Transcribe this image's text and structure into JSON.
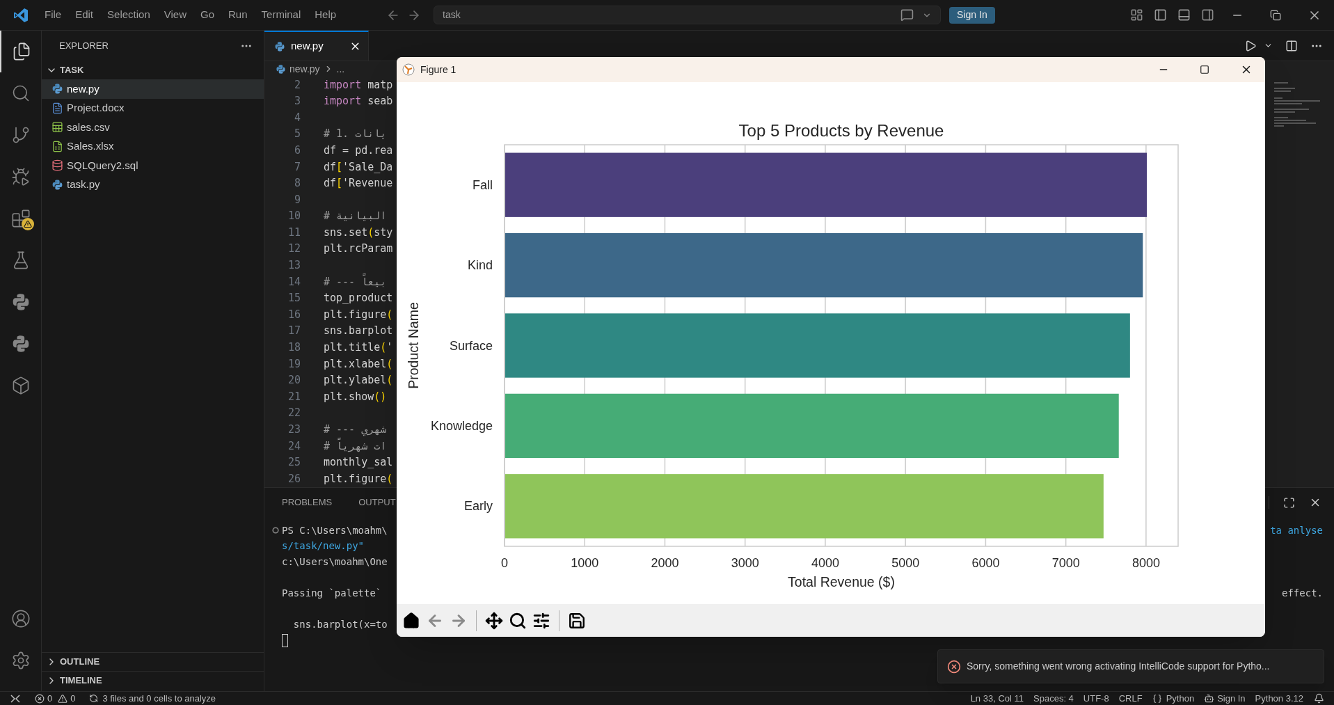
{
  "title_bar": {
    "menu": [
      "File",
      "Edit",
      "Selection",
      "View",
      "Go",
      "Run",
      "Terminal",
      "Help"
    ],
    "search": {
      "value": "task"
    },
    "sign_in": "Sign In"
  },
  "activity_bar": {
    "top": [
      {
        "kind": "explorer",
        "selected": true
      },
      {
        "kind": "search",
        "selected": false
      },
      {
        "kind": "source_control",
        "selected": false
      },
      {
        "kind": "run_debug",
        "selected": false
      },
      {
        "kind": "extensions",
        "selected": false,
        "warning": true
      },
      {
        "kind": "testing",
        "selected": false
      },
      {
        "kind": "python",
        "selected": false
      },
      {
        "kind": "python",
        "selected": false
      },
      {
        "kind": "containers",
        "selected": false
      }
    ],
    "bottom": [
      {
        "kind": "account"
      },
      {
        "kind": "settings"
      }
    ]
  },
  "sidebar": {
    "title": "EXPLORER",
    "folder": {
      "label": "TASK",
      "expanded": true,
      "files": [
        {
          "name": "new.py",
          "kind": "python",
          "selected": true
        },
        {
          "name": "Project.docx",
          "kind": "word",
          "selected": false
        },
        {
          "name": "sales.csv",
          "kind": "csv",
          "selected": false
        },
        {
          "name": "Sales.xlsx",
          "kind": "excel",
          "selected": false
        },
        {
          "name": "SQLQuery2.sql",
          "kind": "sql",
          "selected": false
        },
        {
          "name": "task.py",
          "kind": "python",
          "selected": false
        }
      ]
    },
    "sections": [
      {
        "label": "OUTLINE",
        "expanded": false
      },
      {
        "label": "TIMELINE",
        "expanded": false
      }
    ]
  },
  "editor": {
    "tabs": [
      {
        "label": "new.py",
        "selected": true
      }
    ],
    "breadcrumb": [
      "new.py",
      "..."
    ],
    "lines": [
      {
        "number": "2",
        "tokens": [
          {
            "text": "import",
            "kind": "keyword"
          },
          {
            "text": " matp",
            "kind": "plain"
          }
        ]
      },
      {
        "number": "3",
        "tokens": [
          {
            "text": "import",
            "kind": "keyword"
          },
          {
            "text": " seab",
            "kind": "plain"
          }
        ]
      },
      {
        "number": "4"
      },
      {
        "number": "5",
        "tokens": [
          {
            "text": "# 1. يانات",
            "kind": "comment"
          }
        ]
      },
      {
        "number": "6",
        "tokens": [
          {
            "text": "df = pd.rea",
            "kind": "plain"
          }
        ]
      },
      {
        "number": "7",
        "tokens": [
          {
            "text": "df",
            "kind": "plain"
          },
          {
            "text": "[",
            "kind": "bracket"
          },
          {
            "text": "'Sale_Da",
            "kind": "plain"
          }
        ]
      },
      {
        "number": "8",
        "tokens": [
          {
            "text": "df",
            "kind": "plain"
          },
          {
            "text": "[",
            "kind": "bracket"
          },
          {
            "text": "'Revenue",
            "kind": "plain"
          }
        ]
      },
      {
        "number": "9"
      },
      {
        "number": "10",
        "tokens": [
          {
            "text": "# البيانية",
            "kind": "comment"
          }
        ]
      },
      {
        "number": "11",
        "tokens": [
          {
            "text": "sns.set",
            "kind": "plain"
          },
          {
            "text": "(",
            "kind": "bracket"
          },
          {
            "text": "sty",
            "kind": "plain"
          }
        ]
      },
      {
        "number": "12",
        "tokens": [
          {
            "text": "plt.rcParam",
            "kind": "plain"
          }
        ]
      },
      {
        "number": "13"
      },
      {
        "number": "14",
        "tokens": [
          {
            "text": "# --- بيعاً",
            "kind": "comment"
          }
        ]
      },
      {
        "number": "15",
        "tokens": [
          {
            "text": "top_product",
            "kind": "plain"
          }
        ]
      },
      {
        "number": "16",
        "tokens": [
          {
            "text": "plt.figure",
            "kind": "plain"
          },
          {
            "text": "(",
            "kind": "bracket"
          }
        ]
      },
      {
        "number": "17",
        "tokens": [
          {
            "text": "sns.barplot",
            "kind": "plain"
          }
        ]
      },
      {
        "number": "18",
        "tokens": [
          {
            "text": "plt.title",
            "kind": "plain"
          },
          {
            "text": "(",
            "kind": "bracket"
          },
          {
            "text": "'",
            "kind": "plain"
          }
        ]
      },
      {
        "number": "19",
        "tokens": [
          {
            "text": "plt.xlabel",
            "kind": "plain"
          },
          {
            "text": "(",
            "kind": "bracket"
          }
        ]
      },
      {
        "number": "20",
        "tokens": [
          {
            "text": "plt.ylabel",
            "kind": "plain"
          },
          {
            "text": "(",
            "kind": "bracket"
          }
        ]
      },
      {
        "number": "21",
        "tokens": [
          {
            "text": "plt.show",
            "kind": "plain"
          },
          {
            "text": "()",
            "kind": "bracket"
          }
        ]
      },
      {
        "number": "22"
      },
      {
        "number": "23",
        "tokens": [
          {
            "text": "# --- شهري",
            "kind": "comment"
          }
        ]
      },
      {
        "number": "24",
        "tokens": [
          {
            "text": "# ات شهرياً",
            "kind": "comment"
          }
        ]
      },
      {
        "number": "25",
        "tokens": [
          {
            "text": "monthly_sal",
            "kind": "plain"
          }
        ]
      },
      {
        "number": "26",
        "tokens": [
          {
            "text": "plt.figure",
            "kind": "plain"
          },
          {
            "text": "(",
            "kind": "bracket"
          }
        ]
      }
    ]
  },
  "panel": {
    "tabs": [
      {
        "label": "PROBLEMS",
        "selected": false
      },
      {
        "label": "OUTPUT",
        "selected": false
      }
    ],
    "terminal": [
      {
        "kind": "prompt",
        "text": "PS C:\\Users\\moahm\\",
        "tail": {
          "text": "ta anlyse",
          "kind": "path"
        }
      },
      {
        "kind": "path",
        "text": "s/task/new.py\""
      },
      {
        "kind": "plain",
        "text": "c:\\Users\\moahm\\One"
      },
      {
        "kind": "blank"
      },
      {
        "kind": "plain",
        "text": "Passing `palette`",
        "tail": {
          "text": "effect.",
          "kind": "plain"
        }
      },
      {
        "kind": "blank"
      },
      {
        "kind": "plain",
        "text": "  sns.barplot(x=to"
      },
      {
        "kind": "cursor"
      }
    ]
  },
  "figure_window": {
    "title": "Figure 1",
    "chart_data": {
      "type": "bar",
      "orientation": "horizontal",
      "title": "Top 5 Products by Revenue",
      "xlabel": "Total Revenue ($)",
      "ylabel": "Product Name",
      "categories": [
        "Fall",
        "Kind",
        "Surface",
        "Knowledge",
        "Early"
      ],
      "series": [
        {
          "colors": [
            "#4b3f7c",
            "#3d6889",
            "#2f8883",
            "#46ac76",
            "#8fc55a"
          ],
          "values": [
            8010,
            7960,
            7800,
            7660,
            7470
          ]
        }
      ],
      "xlim": [
        0,
        8400
      ],
      "grid": true,
      "xticks": [
        0,
        1000,
        2000,
        3000,
        4000,
        5000,
        6000,
        7000,
        8000
      ]
    },
    "toolbar": [
      {
        "kind": "home",
        "disabled": false
      },
      {
        "kind": "back",
        "disabled": true
      },
      {
        "kind": "forward",
        "disabled": true
      },
      {
        "kind": "separator"
      },
      {
        "kind": "pan",
        "disabled": false
      },
      {
        "kind": "zoom",
        "disabled": false
      },
      {
        "kind": "configure",
        "disabled": false
      },
      {
        "kind": "separator"
      },
      {
        "kind": "save",
        "disabled": false
      }
    ]
  },
  "notification": {
    "kind": "error",
    "message": "Sorry, something went wrong activating IntelliCode support for Pytho..."
  },
  "status_bar": {
    "errors": "0",
    "warnings": "0",
    "analysis": "3 files and 0 cells to analyze",
    "right": [
      {
        "kind": "text",
        "text": "Ln 33, Col 11"
      },
      {
        "kind": "text",
        "text": "Spaces: 4"
      },
      {
        "kind": "text",
        "text": "UTF-8"
      },
      {
        "kind": "text",
        "text": "CRLF"
      },
      {
        "kind": "language",
        "text": "Python"
      },
      {
        "kind": "account",
        "text": "Sign In"
      },
      {
        "kind": "text",
        "text": "Python 3.12"
      },
      {
        "kind": "bell"
      }
    ]
  }
}
